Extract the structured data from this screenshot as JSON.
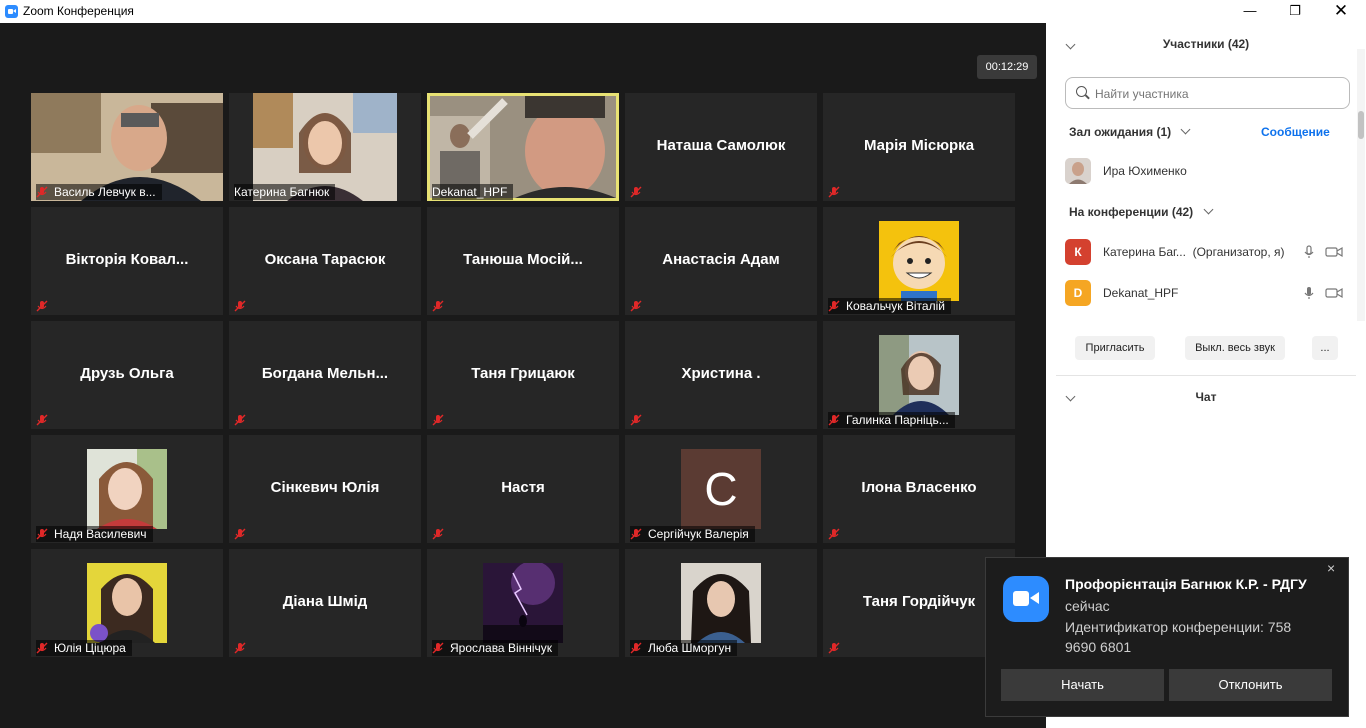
{
  "window": {
    "title": "Zoom Конференция"
  },
  "timer": "00:12:29",
  "tiles": [
    {
      "name": "Василь Левчук в..."
    },
    {
      "name": "Катерина Багнюк"
    },
    {
      "name": "Dekanat_HPF"
    },
    {
      "name": "Наташа Самолюк"
    },
    {
      "name": "Марія Місюрка"
    },
    {
      "name": "Вікторія Ковал..."
    },
    {
      "name": "Оксана Тарасюк"
    },
    {
      "name": "Танюша  Мосій..."
    },
    {
      "name": "Анастасія Адам"
    },
    {
      "name": "Ковальчук Віталій"
    },
    {
      "name": "Друзь Ольга"
    },
    {
      "name": "Богдана  Мельн..."
    },
    {
      "name": "Таня Грицаюк"
    },
    {
      "name": "Христина ."
    },
    {
      "name": "Галинка Парніць..."
    },
    {
      "name": "Надя Василевич"
    },
    {
      "name": "Сінкевич Юлія"
    },
    {
      "name": "Настя"
    },
    {
      "name": "Сергійчук Валерія",
      "avatar_letter": "C"
    },
    {
      "name": "Ілона Власенко"
    },
    {
      "name": "Юлія Ціцюра"
    },
    {
      "name": "Діана Шмід"
    },
    {
      "name": "Ярослава Віннічук"
    },
    {
      "name": "Люба Шморгун"
    },
    {
      "name": "Таня Гордійчук"
    }
  ],
  "panel": {
    "participants_header": "Участники (42)",
    "search_placeholder": "Найти участника",
    "waiting_room": "Зал ожидания (1)",
    "message_link": "Сообщение",
    "waiting": [
      {
        "name": "Ира Юхименко"
      }
    ],
    "in_meeting": "На конференции (42)",
    "participants": [
      {
        "initial": "К",
        "name": "Катерина Баг...",
        "role": "(Организатор, я)",
        "color": "#d4412f"
      },
      {
        "initial": "D",
        "name": "Dekanat_HPF",
        "role": "",
        "color": "#f5a623"
      }
    ],
    "buttons": {
      "invite": "Пригласить",
      "mute_all": "Выкл. весь звук",
      "more": "..."
    },
    "chat_header": "Чат"
  },
  "notification": {
    "title": "Профорієнтація Багнюк К.Р. - РДГУ",
    "time": "сейчас",
    "meeting_id_line1": "Идентификатор конференции: 758",
    "meeting_id_line2": "9690 6801",
    "start": "Начать",
    "decline": "Отклонить",
    "close": "×"
  }
}
